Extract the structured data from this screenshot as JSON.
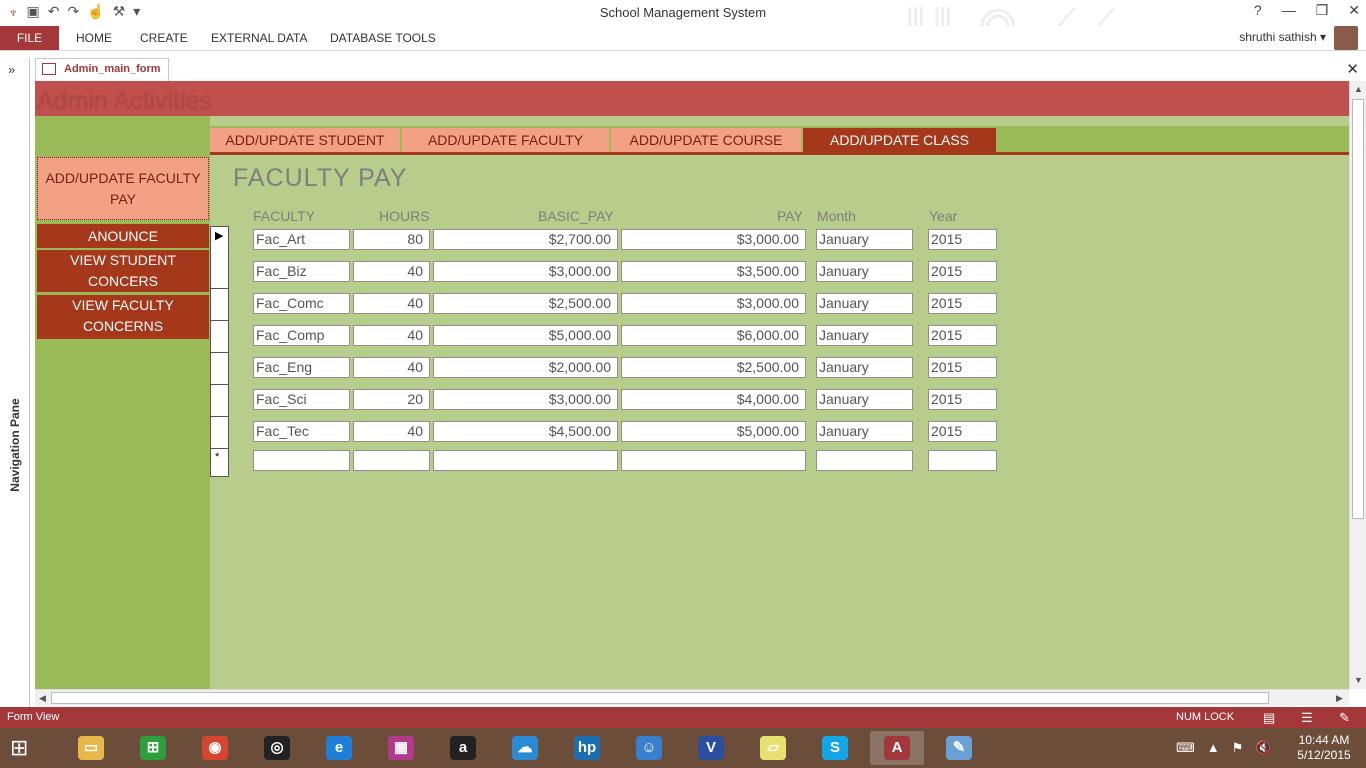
{
  "window": {
    "title": "School Management System",
    "help": "?",
    "minimize": "—",
    "restore": "❐",
    "close": "✕"
  },
  "ribbon": {
    "file": "FILE",
    "tabs": [
      "HOME",
      "CREATE",
      "EXTERNAL DATA",
      "DATABASE TOOLS"
    ],
    "user": "shruthi sathish",
    "user_caret": "▾"
  },
  "nav_pane": {
    "toggle": "»",
    "label": "Navigation Pane"
  },
  "document": {
    "tab_label": "Admin_main_form",
    "close": "✕"
  },
  "form": {
    "header_title": "Admin Activities",
    "tabs": [
      "ADD/UPDATE STUDENT",
      "ADD/UPDATE FACULTY",
      "ADD/UPDATE COURSE",
      "ADD/UPDATE CLASS"
    ],
    "active_tab": 3,
    "side_buttons": [
      "ADD/UPDATE FACULTY PAY",
      "ANOUNCE",
      "VIEW STUDENT CONCERS",
      "VIEW FACULTY CONCERNS"
    ],
    "section_title": "FACULTY  PAY",
    "columns": [
      "FACULTY",
      "HOURS",
      "BASIC_PAY",
      "PAY",
      "Month",
      "Year"
    ],
    "rows": [
      [
        "Fac_Art",
        "80",
        "$2,700.00",
        "$3,000.00",
        "January",
        "2015"
      ],
      [
        "Fac_Biz",
        "40",
        "$3,000.00",
        "$3,500.00",
        "January",
        "2015"
      ],
      [
        "Fac_Comc",
        "40",
        "$2,500.00",
        "$3,000.00",
        "January",
        "2015"
      ],
      [
        "Fac_Comp",
        "40",
        "$5,000.00",
        "$6,000.00",
        "January",
        "2015"
      ],
      [
        "Fac_Eng",
        "40",
        "$2,000.00",
        "$2,500.00",
        "January",
        "2015"
      ],
      [
        "Fac_Sci",
        "20",
        "$3,000.00",
        "$4,000.00",
        "January",
        "2015"
      ],
      [
        "Fac_Tec",
        "40",
        "$4,500.00",
        "$5,000.00",
        "January",
        "2015"
      ]
    ],
    "current_record_marker": "▶",
    "new_record_marker": "*"
  },
  "status": {
    "view": "Form View",
    "numlock": "NUM LOCK"
  },
  "taskbar": {
    "apps": [
      "file-explorer",
      "store",
      "chrome",
      "media",
      "internet-explorer",
      "photos",
      "amazon",
      "onedrive",
      "hp",
      "finder",
      "visio",
      "sticky-notes",
      "skype",
      "access",
      "paint"
    ],
    "active_app": "access",
    "time": "10:44 AM",
    "date": "5/12/2015"
  },
  "colors": {
    "accent": "#a4373a",
    "header": "#c0504d",
    "form_bg": "#b8cc8b",
    "left_panel": "#9bbb59",
    "tab_inactive": "#f2a185",
    "tab_active": "#a5371b"
  }
}
